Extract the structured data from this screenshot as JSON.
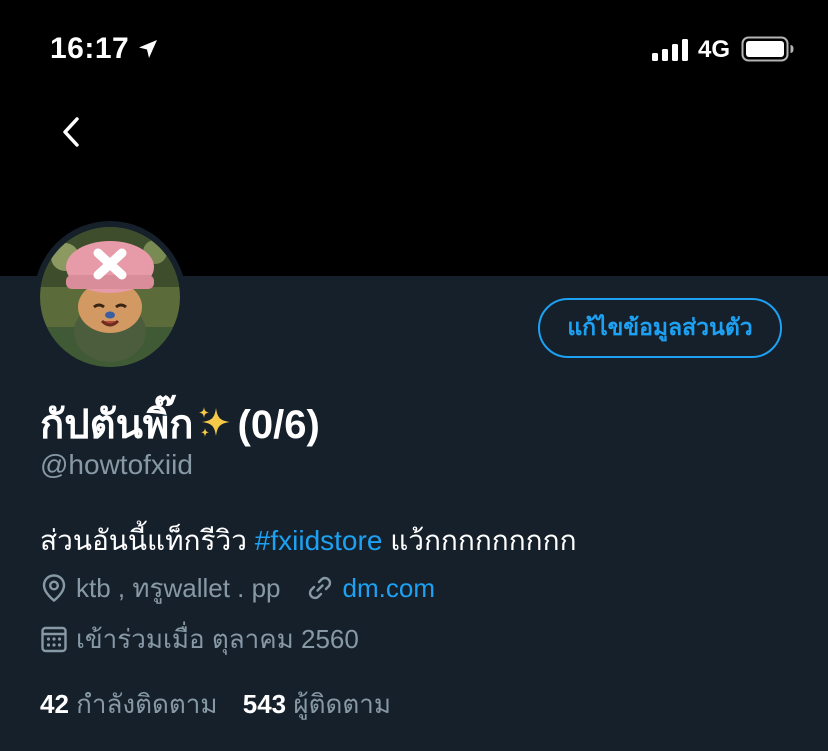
{
  "status_bar": {
    "time": "16:17",
    "network": "4G",
    "icons": [
      "location-arrow-icon",
      "signal-bars-icon",
      "battery-icon"
    ]
  },
  "header": {
    "back_icon": "chevron-left-icon"
  },
  "profile": {
    "edit_button_label": "แก้ไขข้อมูลส่วนตัว",
    "display_name_text": "กัปตันพิ๊ก",
    "display_name_emoji": "sparkles-icon",
    "display_name_suffix": "(0/6)",
    "handle": "@howtofxiid",
    "bio_prefix": "ส่วนอันนี้แท็กรีวิว",
    "bio_hashtag": "#fxiidstore",
    "bio_suffix": "แว้กกกกกกกกก",
    "location": "ktb , ทรูwallet . pp",
    "website": "dm.com",
    "joined": "เข้าร่วมเมื่อ ตุลาคม 2560",
    "following_count": "42",
    "following_label": "กำลังติดตาม",
    "followers_count": "543",
    "followers_label": "ผู้ติดตาม"
  },
  "colors": {
    "background": "#15202b",
    "header": "#000000",
    "accent": "#1da1f2",
    "muted": "#8899a6"
  }
}
